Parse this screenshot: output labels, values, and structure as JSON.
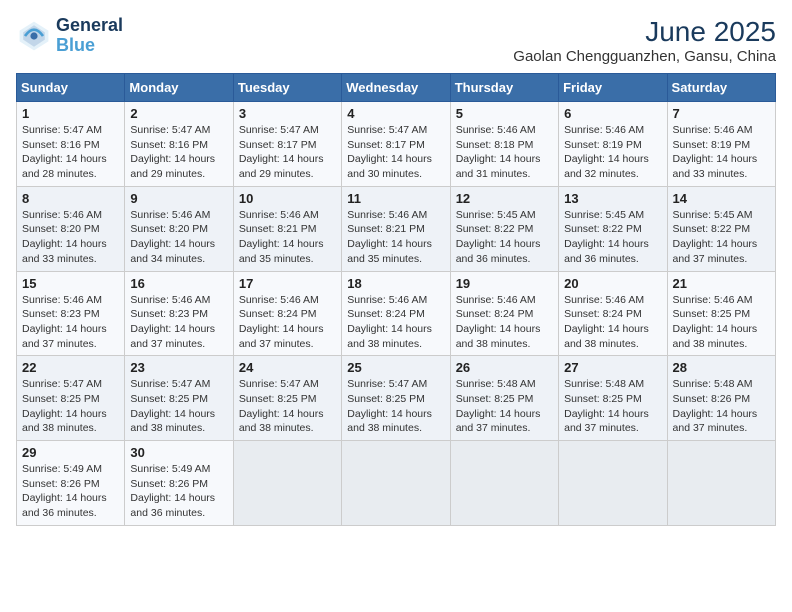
{
  "logo": {
    "line1": "General",
    "line2": "Blue"
  },
  "title": "June 2025",
  "subtitle": "Gaolan Chengguanzhen, Gansu, China",
  "weekdays": [
    "Sunday",
    "Monday",
    "Tuesday",
    "Wednesday",
    "Thursday",
    "Friday",
    "Saturday"
  ],
  "weeks": [
    [
      {
        "day": 1,
        "info": "Sunrise: 5:47 AM\nSunset: 8:16 PM\nDaylight: 14 hours\nand 28 minutes."
      },
      {
        "day": 2,
        "info": "Sunrise: 5:47 AM\nSunset: 8:16 PM\nDaylight: 14 hours\nand 29 minutes."
      },
      {
        "day": 3,
        "info": "Sunrise: 5:47 AM\nSunset: 8:17 PM\nDaylight: 14 hours\nand 29 minutes."
      },
      {
        "day": 4,
        "info": "Sunrise: 5:47 AM\nSunset: 8:17 PM\nDaylight: 14 hours\nand 30 minutes."
      },
      {
        "day": 5,
        "info": "Sunrise: 5:46 AM\nSunset: 8:18 PM\nDaylight: 14 hours\nand 31 minutes."
      },
      {
        "day": 6,
        "info": "Sunrise: 5:46 AM\nSunset: 8:19 PM\nDaylight: 14 hours\nand 32 minutes."
      },
      {
        "day": 7,
        "info": "Sunrise: 5:46 AM\nSunset: 8:19 PM\nDaylight: 14 hours\nand 33 minutes."
      }
    ],
    [
      {
        "day": 8,
        "info": "Sunrise: 5:46 AM\nSunset: 8:20 PM\nDaylight: 14 hours\nand 33 minutes."
      },
      {
        "day": 9,
        "info": "Sunrise: 5:46 AM\nSunset: 8:20 PM\nDaylight: 14 hours\nand 34 minutes."
      },
      {
        "day": 10,
        "info": "Sunrise: 5:46 AM\nSunset: 8:21 PM\nDaylight: 14 hours\nand 35 minutes."
      },
      {
        "day": 11,
        "info": "Sunrise: 5:46 AM\nSunset: 8:21 PM\nDaylight: 14 hours\nand 35 minutes."
      },
      {
        "day": 12,
        "info": "Sunrise: 5:45 AM\nSunset: 8:22 PM\nDaylight: 14 hours\nand 36 minutes."
      },
      {
        "day": 13,
        "info": "Sunrise: 5:45 AM\nSunset: 8:22 PM\nDaylight: 14 hours\nand 36 minutes."
      },
      {
        "day": 14,
        "info": "Sunrise: 5:45 AM\nSunset: 8:22 PM\nDaylight: 14 hours\nand 37 minutes."
      }
    ],
    [
      {
        "day": 15,
        "info": "Sunrise: 5:46 AM\nSunset: 8:23 PM\nDaylight: 14 hours\nand 37 minutes."
      },
      {
        "day": 16,
        "info": "Sunrise: 5:46 AM\nSunset: 8:23 PM\nDaylight: 14 hours\nand 37 minutes."
      },
      {
        "day": 17,
        "info": "Sunrise: 5:46 AM\nSunset: 8:24 PM\nDaylight: 14 hours\nand 37 minutes."
      },
      {
        "day": 18,
        "info": "Sunrise: 5:46 AM\nSunset: 8:24 PM\nDaylight: 14 hours\nand 38 minutes."
      },
      {
        "day": 19,
        "info": "Sunrise: 5:46 AM\nSunset: 8:24 PM\nDaylight: 14 hours\nand 38 minutes."
      },
      {
        "day": 20,
        "info": "Sunrise: 5:46 AM\nSunset: 8:24 PM\nDaylight: 14 hours\nand 38 minutes."
      },
      {
        "day": 21,
        "info": "Sunrise: 5:46 AM\nSunset: 8:25 PM\nDaylight: 14 hours\nand 38 minutes."
      }
    ],
    [
      {
        "day": 22,
        "info": "Sunrise: 5:47 AM\nSunset: 8:25 PM\nDaylight: 14 hours\nand 38 minutes."
      },
      {
        "day": 23,
        "info": "Sunrise: 5:47 AM\nSunset: 8:25 PM\nDaylight: 14 hours\nand 38 minutes."
      },
      {
        "day": 24,
        "info": "Sunrise: 5:47 AM\nSunset: 8:25 PM\nDaylight: 14 hours\nand 38 minutes."
      },
      {
        "day": 25,
        "info": "Sunrise: 5:47 AM\nSunset: 8:25 PM\nDaylight: 14 hours\nand 38 minutes."
      },
      {
        "day": 26,
        "info": "Sunrise: 5:48 AM\nSunset: 8:25 PM\nDaylight: 14 hours\nand 37 minutes."
      },
      {
        "day": 27,
        "info": "Sunrise: 5:48 AM\nSunset: 8:25 PM\nDaylight: 14 hours\nand 37 minutes."
      },
      {
        "day": 28,
        "info": "Sunrise: 5:48 AM\nSunset: 8:26 PM\nDaylight: 14 hours\nand 37 minutes."
      }
    ],
    [
      {
        "day": 29,
        "info": "Sunrise: 5:49 AM\nSunset: 8:26 PM\nDaylight: 14 hours\nand 36 minutes."
      },
      {
        "day": 30,
        "info": "Sunrise: 5:49 AM\nSunset: 8:26 PM\nDaylight: 14 hours\nand 36 minutes."
      },
      null,
      null,
      null,
      null,
      null
    ]
  ]
}
